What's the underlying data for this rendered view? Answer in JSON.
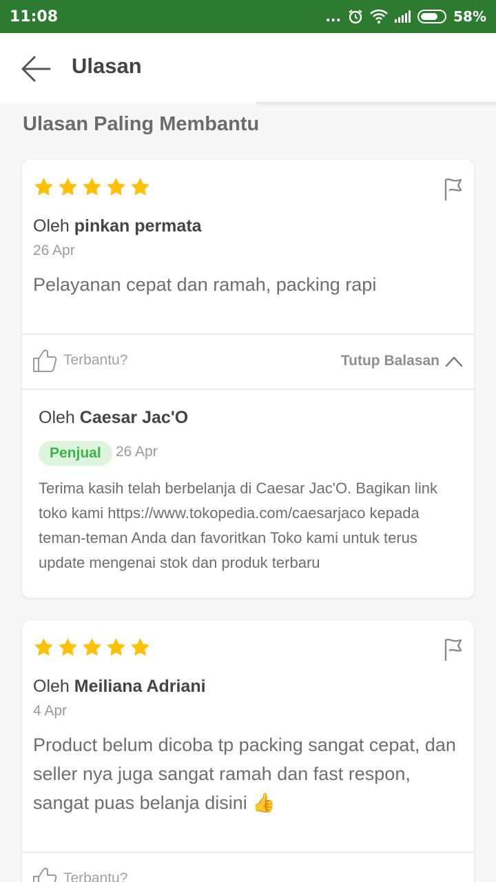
{
  "status_bar": {
    "time": "11:08",
    "dots": "...",
    "battery": "58%"
  },
  "header": {
    "title": "Ulasan"
  },
  "section": {
    "title": "Ulasan Paling Membantu"
  },
  "reviews": [
    {
      "rating": 5,
      "author_prefix": "Oleh",
      "author": "pinkan permata",
      "date": "26 Apr",
      "text": "Pelayanan cepat dan ramah, packing rapi",
      "helpful_label": "Terbantu?",
      "reply_toggle": "Tutup Balasan",
      "reply": {
        "author_prefix": "Oleh",
        "author": "Caesar Jac'O",
        "badge": "Penjual",
        "date": "26 Apr",
        "text": "Terima kasih telah berbelanja di Caesar Jac'O. Bagikan link toko kami https://www.tokopedia.com/caesarjaco kepada teman-teman Anda dan favoritkan Toko kami untuk terus update mengenai stok dan produk terbaru"
      }
    },
    {
      "rating": 5,
      "author_prefix": "Oleh",
      "author": "Meiliana Adriani",
      "date": "4 Apr",
      "text": "Product belum dicoba tp packing sangat cepat, dan seller nya juga sangat ramah dan fast respon, sangat puas belanja disini 👍",
      "helpful_label": "Terbantu?"
    }
  ],
  "colors": {
    "status_bar": "#2d7a31",
    "star": "#ffc107",
    "badge_bg": "#ddf4dd",
    "badge_text": "#3bb44a"
  }
}
